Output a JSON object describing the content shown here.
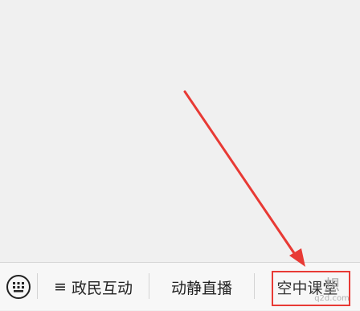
{
  "bottom_bar": {
    "keyboard_icon": "keyboard-icon",
    "menu_items": [
      {
        "prefix": "≡",
        "label": "政民互动"
      },
      {
        "prefix": "",
        "label": "动静直播"
      },
      {
        "prefix": "",
        "label": "空中课堂"
      }
    ]
  },
  "annotation": {
    "arrow_color": "#e83a35",
    "highlight_color": "#e83a35"
  },
  "watermark": {
    "line1": "想",
    "line2": "q2d.com"
  }
}
